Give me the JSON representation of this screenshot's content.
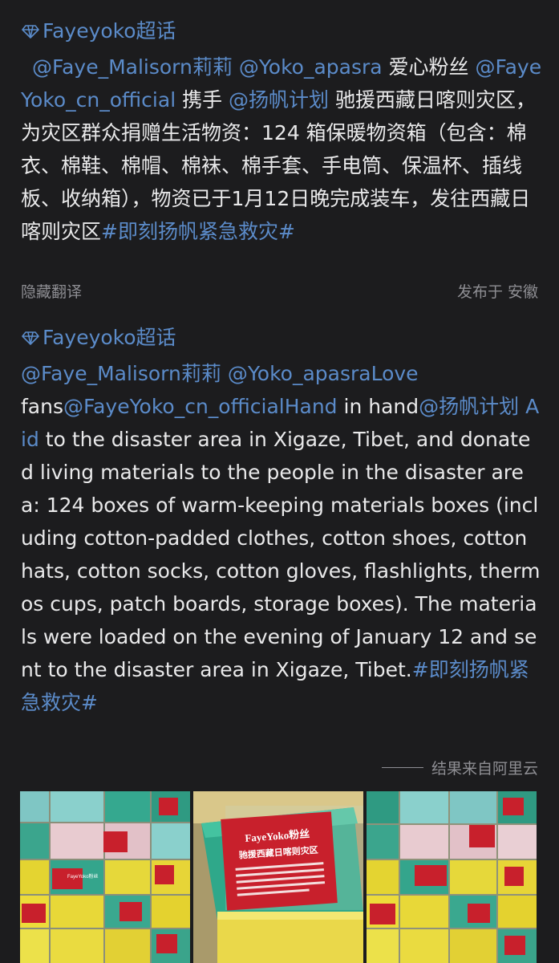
{
  "original": {
    "topic": "Fayeyoko超话",
    "mention1": "@Faye_Malisorn莉莉",
    "mention2": "@Yoko_apasra",
    "text1": " 爱心粉丝 ",
    "mention3": "@FayeYoko_cn_official",
    "text2": " 携手 ",
    "mention4": "@扬帆计划",
    "text3": " 驰援西藏日喀则灾区，为灾区群众捐赠生活物资：124 箱保暖物资箱（包含：棉衣、棉鞋、棉帽、棉袜、棉手套、手电筒、保温杯、插线板、收纳箱），物资已于1月12日晚完成装车，发往西藏日喀则灾区",
    "hashtag": "#即刻扬帆紧急救灾#"
  },
  "meta": {
    "hide_translation": "隐藏翻译",
    "location": "发布于 安徽"
  },
  "translated": {
    "topic": "Fayeyoko超话",
    "mention1": "@Faye_Malisorn莉莉",
    "mention2": "@Yoko_apasraLove",
    "text1": "fans",
    "mention3": "@FayeYoko_cn_officialHand",
    "text2": " in hand",
    "mention4": "@扬帆计划 Aid",
    "text3": " to the disaster area in Xigaze, Tibet, and donated living materials to the people in the disaster area: 124 boxes of warm-keeping materials boxes (including cotton-padded clothes, cotton shoes, cotton hats, cotton socks, cotton gloves, flashlights, thermos cups, patch boards, storage boxes). The materials were loaded on the evening of January 12 and sent to the disaster area in Xigaze, Tibet.",
    "hashtag": "#即刻扬帆紧急救灾#"
  },
  "attribution": "结果来自阿里云",
  "photos": {
    "banner_line1": "FayeYoko粉丝",
    "banner_line2": "驰援西藏日喀则灾区",
    "small_label": "FayeYoko粉丝"
  },
  "colors": {
    "background": "#1c1c1e",
    "link": "#5b8bc9",
    "muted": "#8e8e93",
    "label_red": "#c8202c"
  }
}
